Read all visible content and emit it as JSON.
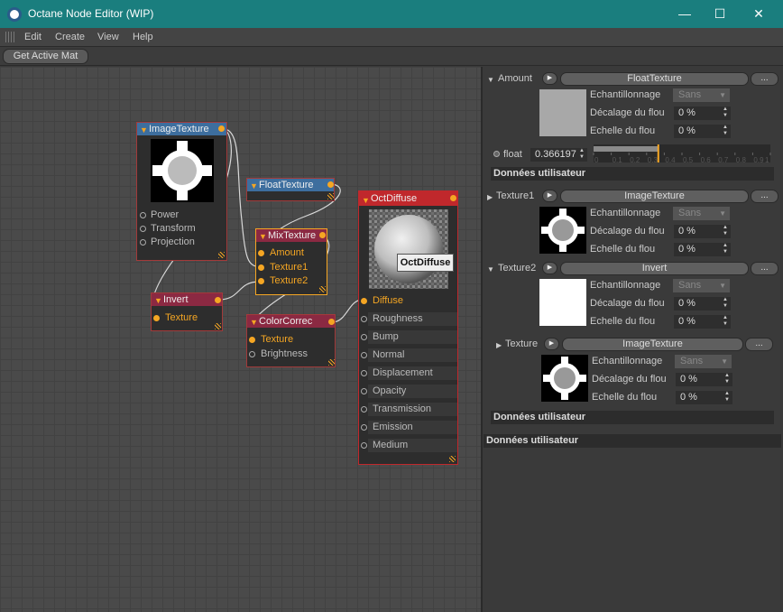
{
  "window": {
    "title": "Octane Node Editor (WIP)",
    "controls": {
      "minimize": "—",
      "maximize": "☐",
      "close": "✕"
    }
  },
  "menu": [
    "Edit",
    "Create",
    "View",
    "Help"
  ],
  "toolbar": {
    "get_active_mat": "Get Active Mat"
  },
  "nodes": {
    "image_texture": {
      "title": "ImageTexture",
      "inputs": [
        "Power",
        "Transform",
        "Projection"
      ]
    },
    "float_texture": {
      "title": "FloatTexture"
    },
    "mix_texture": {
      "title": "MixTexture",
      "inputs": [
        "Amount",
        "Texture1",
        "Texture2"
      ]
    },
    "invert": {
      "title": "Invert",
      "inputs": [
        "Texture"
      ]
    },
    "color_correct": {
      "title": "ColorCorrec",
      "inputs": [
        "Texture",
        "Brightness"
      ]
    },
    "oct_diffuse": {
      "title": "OctDiffuse",
      "inputs": [
        "Diffuse",
        "Roughness",
        "Bump",
        "Normal",
        "Displacement",
        "Opacity",
        "Transmission",
        "Emission",
        "Medium"
      ]
    }
  },
  "tooltip": "OctDiffuse",
  "panel": {
    "amount": {
      "label": "Amount",
      "button": "FloatTexture",
      "more": "...",
      "sampling_label": "Echantillonnage",
      "sampling_value": "Sans",
      "blur_offset_label": "Décalage du flou",
      "blur_offset_value": "0 %",
      "blur_scale_label": "Echelle du flou",
      "blur_scale_value": "0 %",
      "swatch_color": "#a8a8a8"
    },
    "float": {
      "label": "float",
      "value": "0.366197",
      "ticks": [
        "0",
        "0.1",
        "0.2",
        "0.3",
        "0.4",
        "0.5",
        "0.6",
        "0.7",
        "0.8",
        "0.9",
        "1"
      ],
      "level": 0.366197,
      "section": "Données utilisateur"
    },
    "texture1": {
      "label": "Texture1",
      "button": "ImageTexture",
      "more": "...",
      "sampling_label": "Echantillonnage",
      "sampling_value": "Sans",
      "blur_offset_label": "Décalage du flou",
      "blur_offset_value": "0 %",
      "blur_scale_label": "Echelle du flou",
      "blur_scale_value": "0 %"
    },
    "texture2": {
      "label": "Texture2",
      "button": "Invert",
      "more": "...",
      "sampling_label": "Echantillonnage",
      "sampling_value": "Sans",
      "blur_offset_label": "Décalage du flou",
      "blur_offset_value": "0 %",
      "blur_scale_label": "Echelle du flou",
      "blur_scale_value": "0 %",
      "swatch_color": "#ffffff"
    },
    "texture": {
      "label": "Texture",
      "button": "ImageTexture",
      "more": "...",
      "sampling_label": "Echantillonnage",
      "sampling_value": "Sans",
      "blur_offset_label": "Décalage du flou",
      "blur_offset_value": "0 %",
      "blur_scale_label": "Echelle du flou",
      "blur_scale_value": "0 %",
      "section": "Données utilisateur"
    },
    "footer_section": "Données utilisateur"
  },
  "colors": {
    "titlebar": "#1a7e7e",
    "node_blue": "#3d6e9e",
    "node_maroon": "#8b2942",
    "node_red": "#c0282c",
    "port_active": "#f5a623",
    "selected_border": "#f5a623"
  }
}
